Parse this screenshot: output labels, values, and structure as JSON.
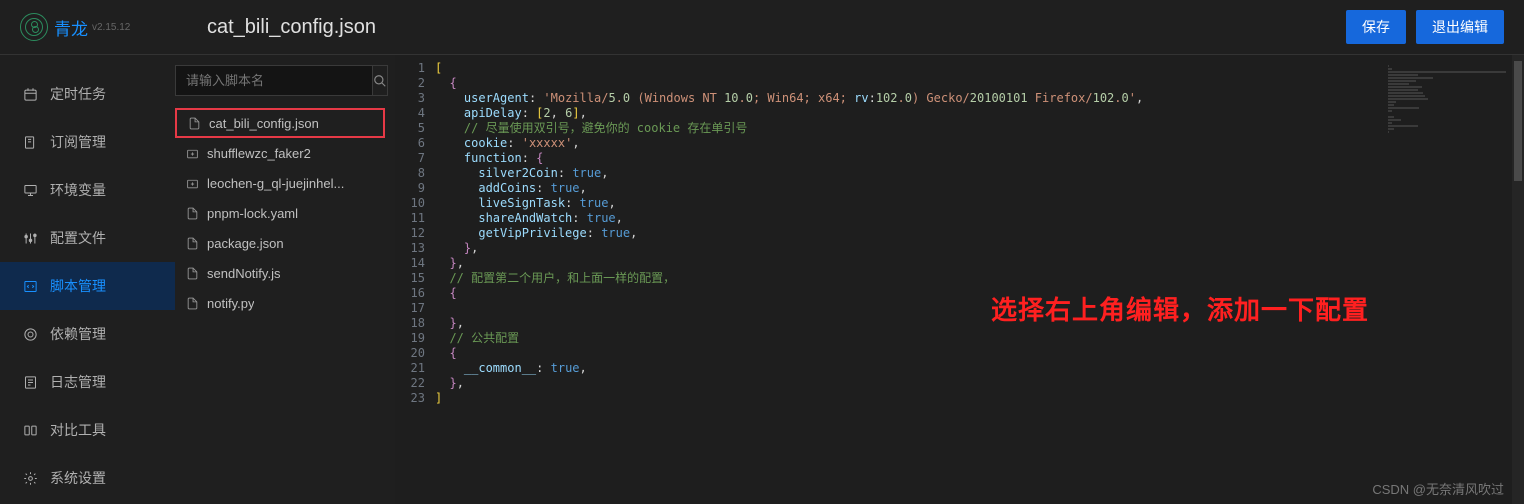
{
  "brand": {
    "name": "青龙",
    "version": "v2.15.12"
  },
  "header": {
    "file_title": "cat_bili_config.json",
    "save_label": "保存",
    "exit_label": "退出编辑"
  },
  "sidebar": {
    "items": [
      {
        "label": "定时任务",
        "icon": "clock"
      },
      {
        "label": "订阅管理",
        "icon": "bookmark"
      },
      {
        "label": "环境变量",
        "icon": "monitor"
      },
      {
        "label": "配置文件",
        "icon": "sliders"
      },
      {
        "label": "脚本管理",
        "icon": "code",
        "active": true
      },
      {
        "label": "依赖管理",
        "icon": "package"
      },
      {
        "label": "日志管理",
        "icon": "log"
      },
      {
        "label": "对比工具",
        "icon": "diff"
      },
      {
        "label": "系统设置",
        "icon": "gear"
      }
    ]
  },
  "search": {
    "placeholder": "请输入脚本名"
  },
  "files": [
    {
      "name": "cat_bili_config.json",
      "type": "file",
      "selected": true
    },
    {
      "name": "shufflewzc_faker2",
      "type": "folder"
    },
    {
      "name": "leochen-g_ql-juejinhel...",
      "type": "folder"
    },
    {
      "name": "pnpm-lock.yaml",
      "type": "file"
    },
    {
      "name": "package.json",
      "type": "file"
    },
    {
      "name": "sendNotify.js",
      "type": "file"
    },
    {
      "name": "notify.py",
      "type": "file"
    }
  ],
  "editor": {
    "lines": [
      "[",
      "  {",
      "    userAgent: 'Mozilla/5.0 (Windows NT 10.0; Win64; x64; rv:102.0) Gecko/20100101 Firefox/102.0',",
      "    apiDelay: [2, 6],",
      "    // 尽量使用双引号，避免你的 cookie 存在单引号",
      "    cookie: 'xxxxx',",
      "    function: {",
      "      silver2Coin: true,",
      "      addCoins: true,",
      "      liveSignTask: true,",
      "      shareAndWatch: true,",
      "      getVipPrivilege: true,",
      "    },",
      "  },",
      "  // 配置第二个用户，和上面一样的配置，",
      "  {",
      "",
      "  },",
      "  // 公共配置",
      "  {",
      "    __common__: true,",
      "  },",
      "]"
    ]
  },
  "annotation": "选择右上角编辑，添加一下配置",
  "watermark": "CSDN @无奈清风吹过"
}
